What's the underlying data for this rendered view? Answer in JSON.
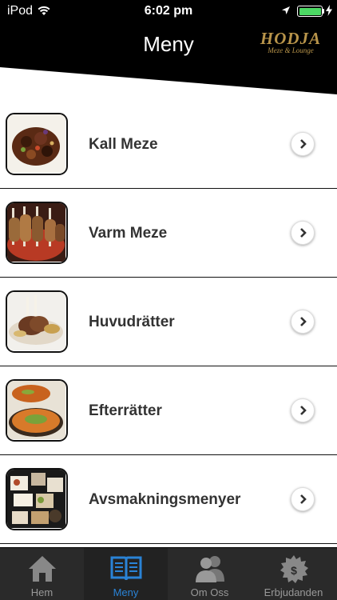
{
  "status_bar": {
    "carrier": "iPod",
    "time": "6:02 pm"
  },
  "header": {
    "title": "Meny",
    "logo": {
      "name": "HODJA",
      "tagline": "Meze & Lounge"
    }
  },
  "menu": {
    "items": [
      {
        "label": "Kall Meze",
        "thumbnail": "cold-meze-photo"
      },
      {
        "label": "Varm Meze",
        "thumbnail": "warm-meze-photo"
      },
      {
        "label": "Huvudrätter",
        "thumbnail": "main-course-photo"
      },
      {
        "label": "Efterrätter",
        "thumbnail": "dessert-photo"
      },
      {
        "label": "Avsmakningsmenyer",
        "thumbnail": "tasting-menu-photo"
      }
    ]
  },
  "tabbar": {
    "tabs": [
      {
        "label": "Hem",
        "icon": "home-icon",
        "active": false
      },
      {
        "label": "Meny",
        "icon": "book-icon",
        "active": true
      },
      {
        "label": "Om Oss",
        "icon": "people-icon",
        "active": false
      },
      {
        "label": "Erbjudanden",
        "icon": "dollar-badge-icon",
        "active": false
      }
    ]
  },
  "colors": {
    "header_bg": "#000000",
    "active_tab": "#2a83d6",
    "tab_bg": "#2a2a2a",
    "battery": "#4cd964",
    "logo_gold": "#b8944a"
  }
}
